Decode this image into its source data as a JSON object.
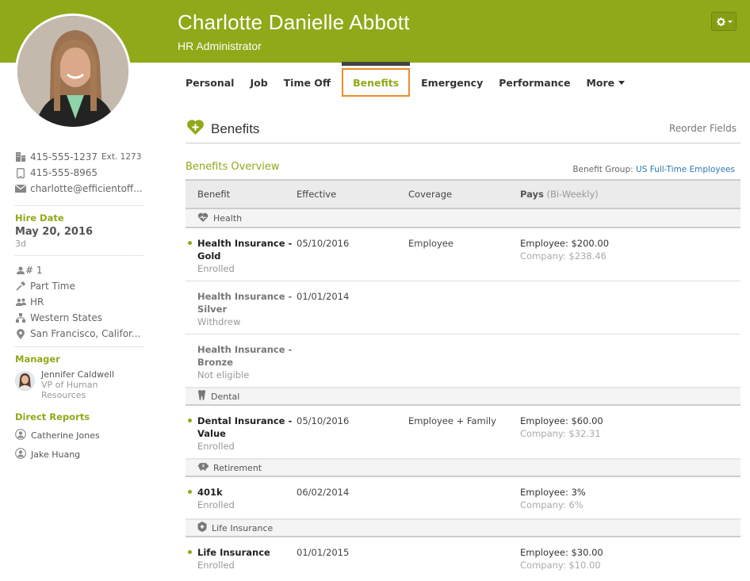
{
  "header": {
    "name": "Charlotte Danielle Abbott",
    "title": "HR Administrator",
    "settings_icon": "gear-icon",
    "brand_color": "#8fa918"
  },
  "tabs": [
    {
      "label": "Personal",
      "active": false
    },
    {
      "label": "Job",
      "active": false
    },
    {
      "label": "Time Off",
      "active": false
    },
    {
      "label": "Benefits",
      "active": true
    },
    {
      "label": "Emergency",
      "active": false
    },
    {
      "label": "Performance",
      "active": false
    },
    {
      "label": "More",
      "active": false
    }
  ],
  "section": {
    "title": "Benefits",
    "icon": "heart-plus-icon",
    "reorder_label": "Reorder Fields"
  },
  "overview": {
    "title": "Benefits Overview",
    "group_label": "Benefit Group:",
    "group_value": "US Full-Time Employees",
    "columns": {
      "benefit": "Benefit",
      "effective": "Effective",
      "coverage": "Coverage",
      "pays": "Pays",
      "pays_period": "(Bi-Weekly)"
    },
    "groups": [
      {
        "label": "Health",
        "icon": "heartbeat-icon",
        "rows": [
          {
            "name": "Health Insurance - Gold",
            "status": "Enrolled",
            "enrolled": true,
            "effective": "05/10/2016",
            "coverage": "Employee",
            "pay_employee": "Employee: $200.00",
            "pay_company": "Company: $238.46"
          },
          {
            "name": "Health Insurance - Silver",
            "status": "Withdrew",
            "enrolled": false,
            "effective": "01/01/2014",
            "coverage": "",
            "pay_employee": "",
            "pay_company": ""
          },
          {
            "name": "Health Insurance - Bronze",
            "status": "Not eligible",
            "enrolled": false,
            "effective": "",
            "coverage": "",
            "pay_employee": "",
            "pay_company": ""
          }
        ]
      },
      {
        "label": "Dental",
        "icon": "tooth-icon",
        "rows": [
          {
            "name": "Dental Insurance - Value",
            "status": "Enrolled",
            "enrolled": true,
            "effective": "05/10/2016",
            "coverage": "Employee + Family",
            "pay_employee": "Employee: $60.00",
            "pay_company": "Company: $32.31"
          }
        ]
      },
      {
        "label": "Retirement",
        "icon": "piggy-bank-icon",
        "rows": [
          {
            "name": "401k",
            "status": "Enrolled",
            "enrolled": true,
            "effective": "06/02/2014",
            "coverage": "",
            "pay_employee": "Employee: 3%",
            "pay_company": "Company: 6%"
          }
        ]
      },
      {
        "label": "Life Insurance",
        "icon": "shield-plus-icon",
        "rows": [
          {
            "name": "Life Insurance",
            "status": "Enrolled",
            "enrolled": true,
            "effective": "01/01/2015",
            "coverage": "",
            "pay_employee": "Employee: $30.00",
            "pay_company": "Company: $10.00"
          }
        ]
      }
    ]
  },
  "sidebar": {
    "work_phone": "415-555-1237",
    "work_ext": "Ext. 1273",
    "mobile_phone": "415-555-8965",
    "email": "charlotte@efficientoff...",
    "hire_date_label": "Hire Date",
    "hire_date": "May 20, 2016",
    "tenure": "3d",
    "employee_number": "# 1",
    "employment_status": "Part Time",
    "department": "HR",
    "division": "Western States",
    "location": "San Francisco, Califor...",
    "manager_label": "Manager",
    "manager_name": "Jennifer Caldwell",
    "manager_title": "VP of Human Resources",
    "reports_label": "Direct Reports",
    "reports": [
      "Catherine Jones",
      "Jake Huang"
    ]
  }
}
